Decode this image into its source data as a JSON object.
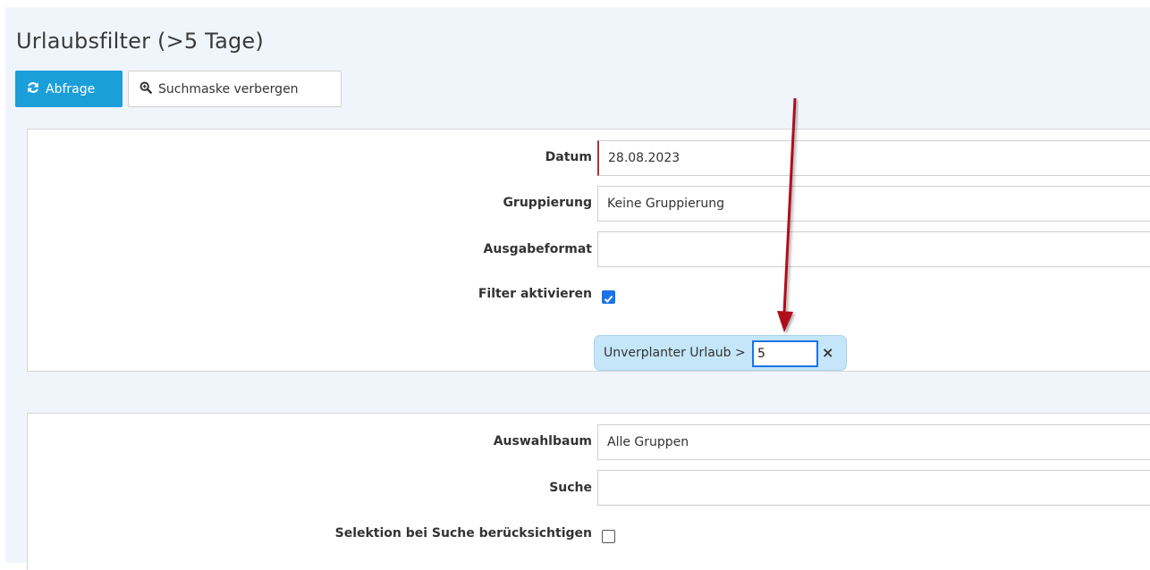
{
  "page": {
    "title": "Urlaubsfilter (>5 Tage)"
  },
  "toolbar": {
    "query_label": "Abfrage",
    "toggle_mask_label": "Suchmaske verbergen"
  },
  "form1": {
    "datum": {
      "label": "Datum",
      "value": "28.08.2023"
    },
    "gruppierung": {
      "label": "Gruppierung",
      "value": "Keine Gruppierung"
    },
    "ausgabeformat": {
      "label": "Ausgabeformat",
      "value": ""
    },
    "filter": {
      "label": "Filter aktivieren",
      "checked": true
    },
    "filter_chip": {
      "label": "Unverplanter Urlaub >",
      "value": "5",
      "remove": "×"
    }
  },
  "form2": {
    "auswahlbaum": {
      "label": "Auswahlbaum",
      "value": "Alle Gruppen"
    },
    "suche": {
      "label": "Suche",
      "value": ""
    },
    "selektion": {
      "label": "Selektion bei Suche berücksichtigen",
      "checked": false
    }
  },
  "icons": {
    "query": "refresh-icon",
    "toggle_mask": "zoom-icon",
    "annotation": "red-arrow"
  },
  "colors": {
    "primary": "#1b9fd9",
    "checkbox": "#1a73e8",
    "chip_bg": "#c5e6f8",
    "arrow": "#b0101a",
    "background": "#f0f5fb"
  }
}
